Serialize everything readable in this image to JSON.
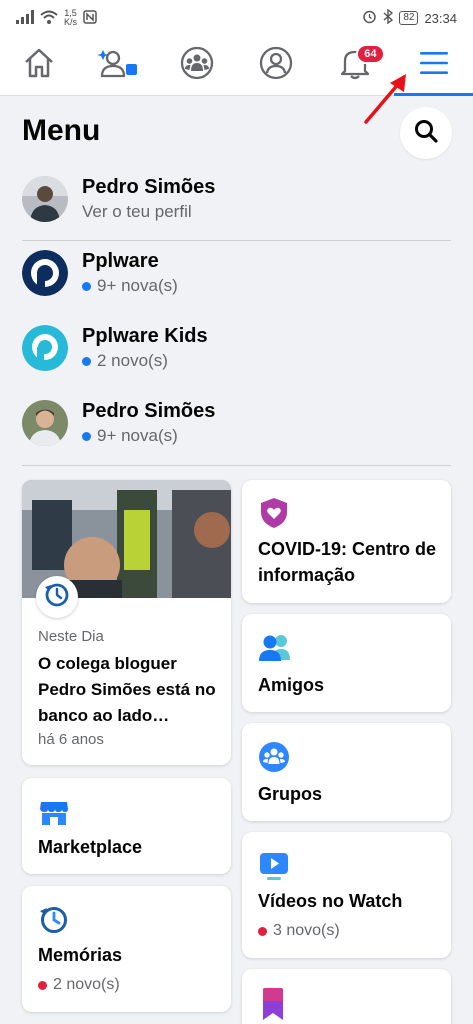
{
  "status": {
    "speed_value": "1,5",
    "speed_unit": "K/s",
    "battery": "82",
    "time": "23:34"
  },
  "nav": {
    "notifications_badge": "64"
  },
  "menu": {
    "title": "Menu"
  },
  "profile": {
    "name": "Pedro Simões",
    "subtitle": "Ver o teu perfil"
  },
  "pages": [
    {
      "name": "Pplware",
      "sub": "9+ nova(s)"
    },
    {
      "name": "Pplware Kids",
      "sub": "2 novo(s)"
    },
    {
      "name": "Pedro Simões",
      "sub": "9+ nova(s)"
    }
  ],
  "memory_card": {
    "kicker": "Neste Dia",
    "title": "O colega bloguer Pedro Simões está no banco ao lado…",
    "time": "há 6 anos"
  },
  "shortcuts_left": [
    {
      "label": "Marketplace",
      "icon": "shop-icon"
    },
    {
      "label": "Memórias",
      "sub": "2 novo(s)",
      "icon": "clock-icon"
    }
  ],
  "shortcuts_right": [
    {
      "label": "COVID-19: Centro de informação",
      "icon": "heart-shield-icon"
    },
    {
      "label": "Amigos",
      "icon": "friends-icon"
    },
    {
      "label": "Grupos",
      "icon": "groups-icon"
    },
    {
      "label": "Vídeos no Watch",
      "sub": "3 novo(s)",
      "icon": "watch-icon"
    },
    {
      "label": "",
      "icon": "bookmark-icon"
    }
  ],
  "colors": {
    "brand_blue": "#1877f2",
    "badge_red": "#e41e3f",
    "dot_blue": "#1877f2",
    "dot_red": "#e41e3f",
    "annotation_arrow": "#e8111b"
  }
}
